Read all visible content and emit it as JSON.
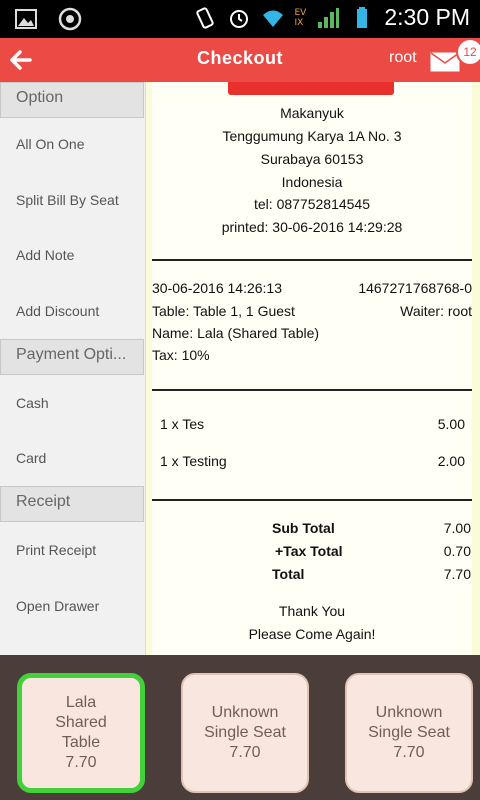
{
  "status_bar": {
    "time": "2:30 PM",
    "network_label_1": "EV",
    "network_label_2": "IX"
  },
  "action_bar": {
    "title": "Checkout",
    "user": "root",
    "mail_badge": "12"
  },
  "sidebar": {
    "sections": [
      {
        "header": "Option",
        "items": [
          "All On One",
          "Split Bill By Seat",
          "Add Note",
          "Add Discount"
        ]
      },
      {
        "header": "Payment Opti...",
        "items": [
          "Cash",
          "Card"
        ]
      },
      {
        "header": "Receipt",
        "items": [
          "Print Receipt",
          "Open Drawer"
        ]
      }
    ]
  },
  "receipt": {
    "store_name": "Makanyuk",
    "address_line1": "Tenggumung Karya 1A No. 3",
    "address_line2": "Surabaya 60153",
    "country": "Indonesia",
    "tel": "tel:  087752814545",
    "printed": "printed: 30-06-2016 14:29:28",
    "order_datetime": "30-06-2016 14:26:13",
    "order_id": "1467271768768-0",
    "table": "Table: Table 1, 1 Guest",
    "waiter": "Waiter: root",
    "name": "Name: Lala (Shared Table)",
    "tax": "Tax: 10%",
    "items": [
      {
        "desc": "1 x Tes",
        "amount": "5.00"
      },
      {
        "desc": "1 x Testing",
        "amount": "2.00"
      }
    ],
    "subtotal_label": "Sub Total",
    "subtotal": "7.00",
    "tax_total_label": "+Tax Total",
    "tax_total": "0.70",
    "total_label": "Total",
    "total": "7.70",
    "thanks": "Thank You",
    "come_again": "Please Come Again!"
  },
  "seats": [
    {
      "line1": "Lala",
      "line2": "Shared",
      "line3": "Table",
      "amount": "7.70",
      "selected": true
    },
    {
      "line1": "Unknown",
      "line2": "Single Seat",
      "line3": "",
      "amount": "7.70",
      "selected": false
    },
    {
      "line1": "Unknown",
      "line2": "Single Seat",
      "line3": "",
      "amount": "7.70",
      "selected": false
    }
  ],
  "colors": {
    "accent": "#ec4a45",
    "selected_border": "#43d13b",
    "seat_background": "#f9e7df",
    "bottom_bar": "#4a3d3a"
  }
}
